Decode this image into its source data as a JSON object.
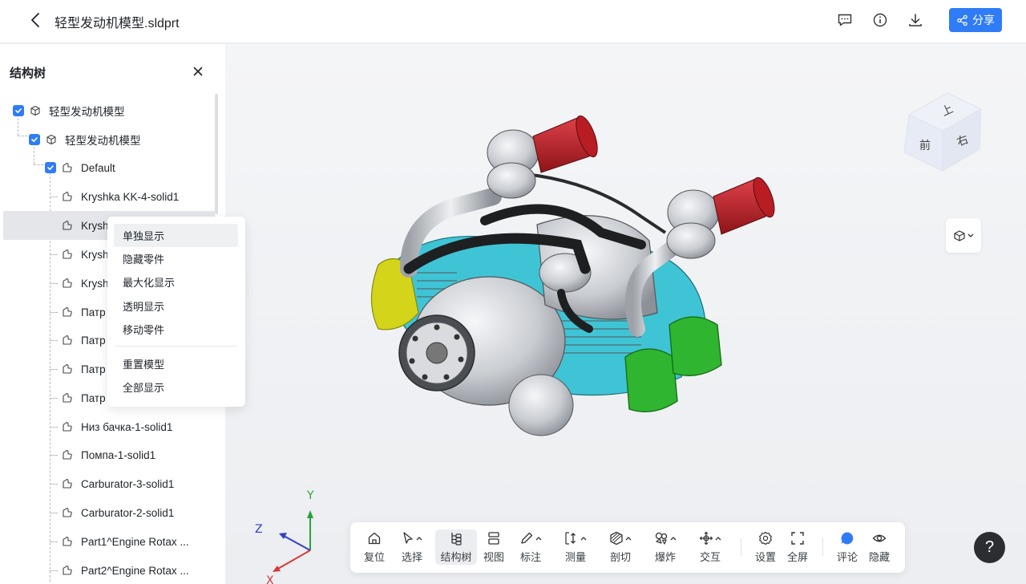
{
  "header": {
    "title": "轻型发动机模型.sldprt",
    "share_label": "分享"
  },
  "sidebar": {
    "title": "结构树",
    "tree": [
      {
        "label": "轻型发动机模型",
        "level": 0,
        "checked": true,
        "icon": "assembly-icon"
      },
      {
        "label": "轻型发动机模型",
        "level": 1,
        "checked": true,
        "icon": "assembly-icon"
      },
      {
        "label": "Default",
        "level": 2,
        "checked": true,
        "icon": "part-icon"
      },
      {
        "label": "Kryshka KK-4-solid1",
        "level": 3,
        "icon": "part-icon"
      },
      {
        "label": "Krysh",
        "level": 3,
        "icon": "part-icon",
        "selected": true
      },
      {
        "label": "Krysh",
        "level": 3,
        "icon": "part-icon"
      },
      {
        "label": "Krysh",
        "level": 3,
        "icon": "part-icon"
      },
      {
        "label": "Патр",
        "level": 3,
        "icon": "part-icon"
      },
      {
        "label": "Патр",
        "level": 3,
        "icon": "part-icon"
      },
      {
        "label": "Патр",
        "level": 3,
        "icon": "part-icon"
      },
      {
        "label": "Патр",
        "level": 3,
        "icon": "part-icon"
      },
      {
        "label": "Низ бачка-1-solid1",
        "level": 3,
        "icon": "part-icon"
      },
      {
        "label": "Помпа-1-solid1",
        "level": 3,
        "icon": "part-icon"
      },
      {
        "label": "Carburator-3-solid1",
        "level": 3,
        "icon": "part-icon"
      },
      {
        "label": "Carburator-2-solid1",
        "level": 3,
        "icon": "part-icon"
      },
      {
        "label": "Part1^Engine Rotax ...",
        "level": 3,
        "icon": "part-icon"
      },
      {
        "label": "Part2^Engine Rotax ...",
        "level": 3,
        "icon": "part-icon"
      }
    ]
  },
  "context_menu": {
    "items": [
      "单独显示",
      "隐藏零件",
      "最大化显示",
      "透明显示",
      "移动零件",
      "重置模型",
      "全部显示"
    ]
  },
  "viewport": {
    "view_cube": {
      "top": "上",
      "front": "前",
      "right": "右"
    },
    "axes": {
      "x": "X",
      "y": "Y",
      "z": "Z"
    }
  },
  "toolbar": {
    "items": [
      {
        "label": "复位",
        "icon": "home-icon"
      },
      {
        "label": "选择",
        "icon": "cursor-icon"
      },
      {
        "label": "结构树",
        "icon": "tree-icon"
      },
      {
        "label": "视图",
        "icon": "view-icon"
      },
      {
        "label": "标注",
        "icon": "pen-icon"
      },
      {
        "label": "测量",
        "icon": "measure-icon"
      },
      {
        "label": "剖切",
        "icon": "section-icon"
      },
      {
        "label": "爆炸",
        "icon": "explode-icon"
      },
      {
        "label": "交互",
        "icon": "interact-icon"
      },
      {
        "label": "设置",
        "icon": "gear-icon"
      },
      {
        "label": "全屏",
        "icon": "fullscreen-icon"
      },
      {
        "label": "评论",
        "icon": "comment-icon"
      },
      {
        "label": "隐藏",
        "icon": "eye-icon"
      }
    ]
  },
  "help": {
    "label": "?"
  },
  "colors": {
    "accent": "#2f7cf6",
    "selected_part": "#d4d41a",
    "green_parts": "#2fb52f",
    "intake_filter": "#c0232b",
    "cyan_parts": "#3fc4d6"
  }
}
